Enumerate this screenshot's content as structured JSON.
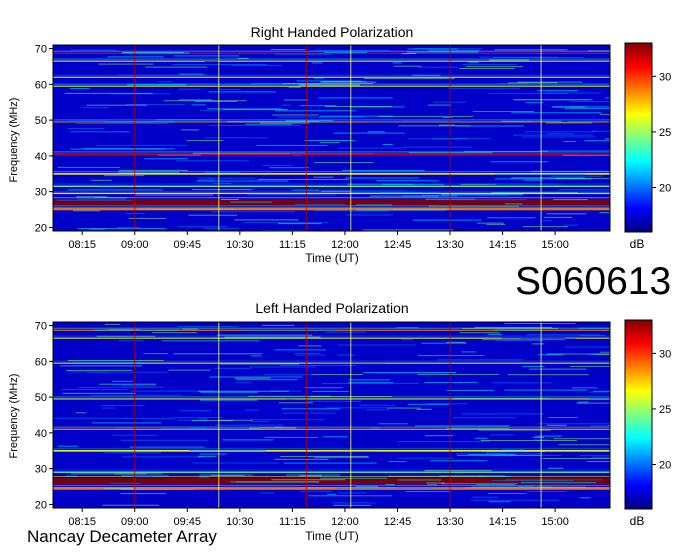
{
  "event_id": "S060613",
  "instrument": "Nancay Decameter Array",
  "colorbar": {
    "unit": "dB",
    "range": [
      16,
      33
    ],
    "ticks": [
      "20",
      "25",
      "30"
    ],
    "tick_values": [
      20,
      25,
      30
    ],
    "colors": [
      "#00007f",
      "#0000ff",
      "#007fff",
      "#00ffff",
      "#7fff7f",
      "#ffff00",
      "#ff7f00",
      "#ff0000",
      "#7f0000"
    ]
  },
  "chart_data": [
    {
      "type": "heatmap",
      "title": "Right Handed Polarization",
      "xlabel": "Time (UT)",
      "ylabel": "Frequency (MHz)",
      "xticks": [
        "08:15",
        "09:00",
        "09:45",
        "10:30",
        "11:15",
        "12:00",
        "12:45",
        "13:30",
        "14:15",
        "15:00"
      ],
      "xtick_minutes": [
        495,
        540,
        585,
        630,
        675,
        720,
        765,
        810,
        855,
        900
      ],
      "yticks": [
        "20",
        "30",
        "40",
        "50",
        "60",
        "70"
      ],
      "ytick_values": [
        20,
        30,
        40,
        50,
        60,
        70
      ],
      "xlim_minutes": [
        470,
        947
      ],
      "ylim": [
        19,
        71
      ],
      "value_unit": "dB",
      "bands": [
        {
          "freq": 27.0,
          "width": 1.8,
          "level": 32
        },
        {
          "freq": 25.2,
          "width": 0.8,
          "level": 28
        },
        {
          "freq": 29.5,
          "width": 0.4,
          "level": 26
        },
        {
          "freq": 31.5,
          "width": 0.4,
          "level": 25
        },
        {
          "freq": 35.0,
          "width": 0.5,
          "level": 27
        },
        {
          "freq": 40.5,
          "width": 0.4,
          "level": 30
        },
        {
          "freq": 49.5,
          "width": 0.3,
          "level": 28
        },
        {
          "freq": 59.5,
          "width": 0.3,
          "level": 27
        },
        {
          "freq": 62.0,
          "width": 0.3,
          "level": 26
        },
        {
          "freq": 66.5,
          "width": 0.3,
          "level": 27
        },
        {
          "freq": 68.7,
          "width": 0.3,
          "level": 30
        }
      ],
      "time_markers": [
        540,
        612,
        687,
        725,
        810,
        888
      ]
    },
    {
      "type": "heatmap",
      "title": "Left Handed Polarization",
      "xlabel": "Time (UT)",
      "ylabel": "Frequency (MHz)",
      "xticks": [
        "08:15",
        "09:00",
        "09:45",
        "10:30",
        "11:15",
        "12:00",
        "12:45",
        "13:30",
        "14:15",
        "15:00"
      ],
      "xtick_minutes": [
        495,
        540,
        585,
        630,
        675,
        720,
        765,
        810,
        855,
        900
      ],
      "yticks": [
        "20",
        "30",
        "40",
        "50",
        "60",
        "70"
      ],
      "ytick_values": [
        20,
        30,
        40,
        50,
        60,
        70
      ],
      "xlim_minutes": [
        470,
        947
      ],
      "ylim": [
        19,
        71
      ],
      "value_unit": "dB",
      "bands": [
        {
          "freq": 26.5,
          "width": 1.8,
          "level": 32
        },
        {
          "freq": 24.5,
          "width": 0.8,
          "level": 28
        },
        {
          "freq": 29.0,
          "width": 0.4,
          "level": 25
        },
        {
          "freq": 35.0,
          "width": 0.5,
          "level": 26
        },
        {
          "freq": 41.0,
          "width": 0.4,
          "level": 29
        },
        {
          "freq": 49.5,
          "width": 0.3,
          "level": 27
        },
        {
          "freq": 59.5,
          "width": 0.3,
          "level": 26
        },
        {
          "freq": 66.5,
          "width": 0.3,
          "level": 26
        },
        {
          "freq": 68.7,
          "width": 0.3,
          "level": 29
        }
      ],
      "time_markers": [
        540,
        612,
        687,
        725,
        810,
        888
      ]
    }
  ]
}
